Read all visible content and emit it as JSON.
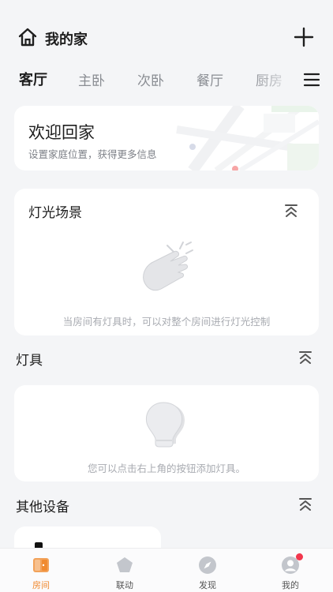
{
  "header": {
    "title": "我的家"
  },
  "tabs": [
    {
      "label": "客厅",
      "active": true
    },
    {
      "label": "主卧"
    },
    {
      "label": "次卧"
    },
    {
      "label": "餐厅"
    },
    {
      "label": "厨房"
    }
  ],
  "welcome": {
    "title": "欢迎回家",
    "subtitle": "设置家庭位置，获得更多信息"
  },
  "scene": {
    "title": "灯光场景",
    "hint": "当房间有灯具时，可以对整个房间进行灯光控制"
  },
  "lamps": {
    "title": "灯具",
    "hint": "您可以点击右上角的按钮添加灯具。"
  },
  "other_devices": {
    "title": "其他设备"
  },
  "bottom_nav": [
    {
      "label": "房间",
      "icon": "room-icon",
      "active": true
    },
    {
      "label": "联动",
      "icon": "automation-icon"
    },
    {
      "label": "发现",
      "icon": "compass-icon"
    },
    {
      "label": "我的",
      "icon": "profile-icon",
      "badge": true
    }
  ],
  "colors": {
    "accent": "#f08a30",
    "badge": "#f2374d",
    "background": "#f4f5f7"
  }
}
